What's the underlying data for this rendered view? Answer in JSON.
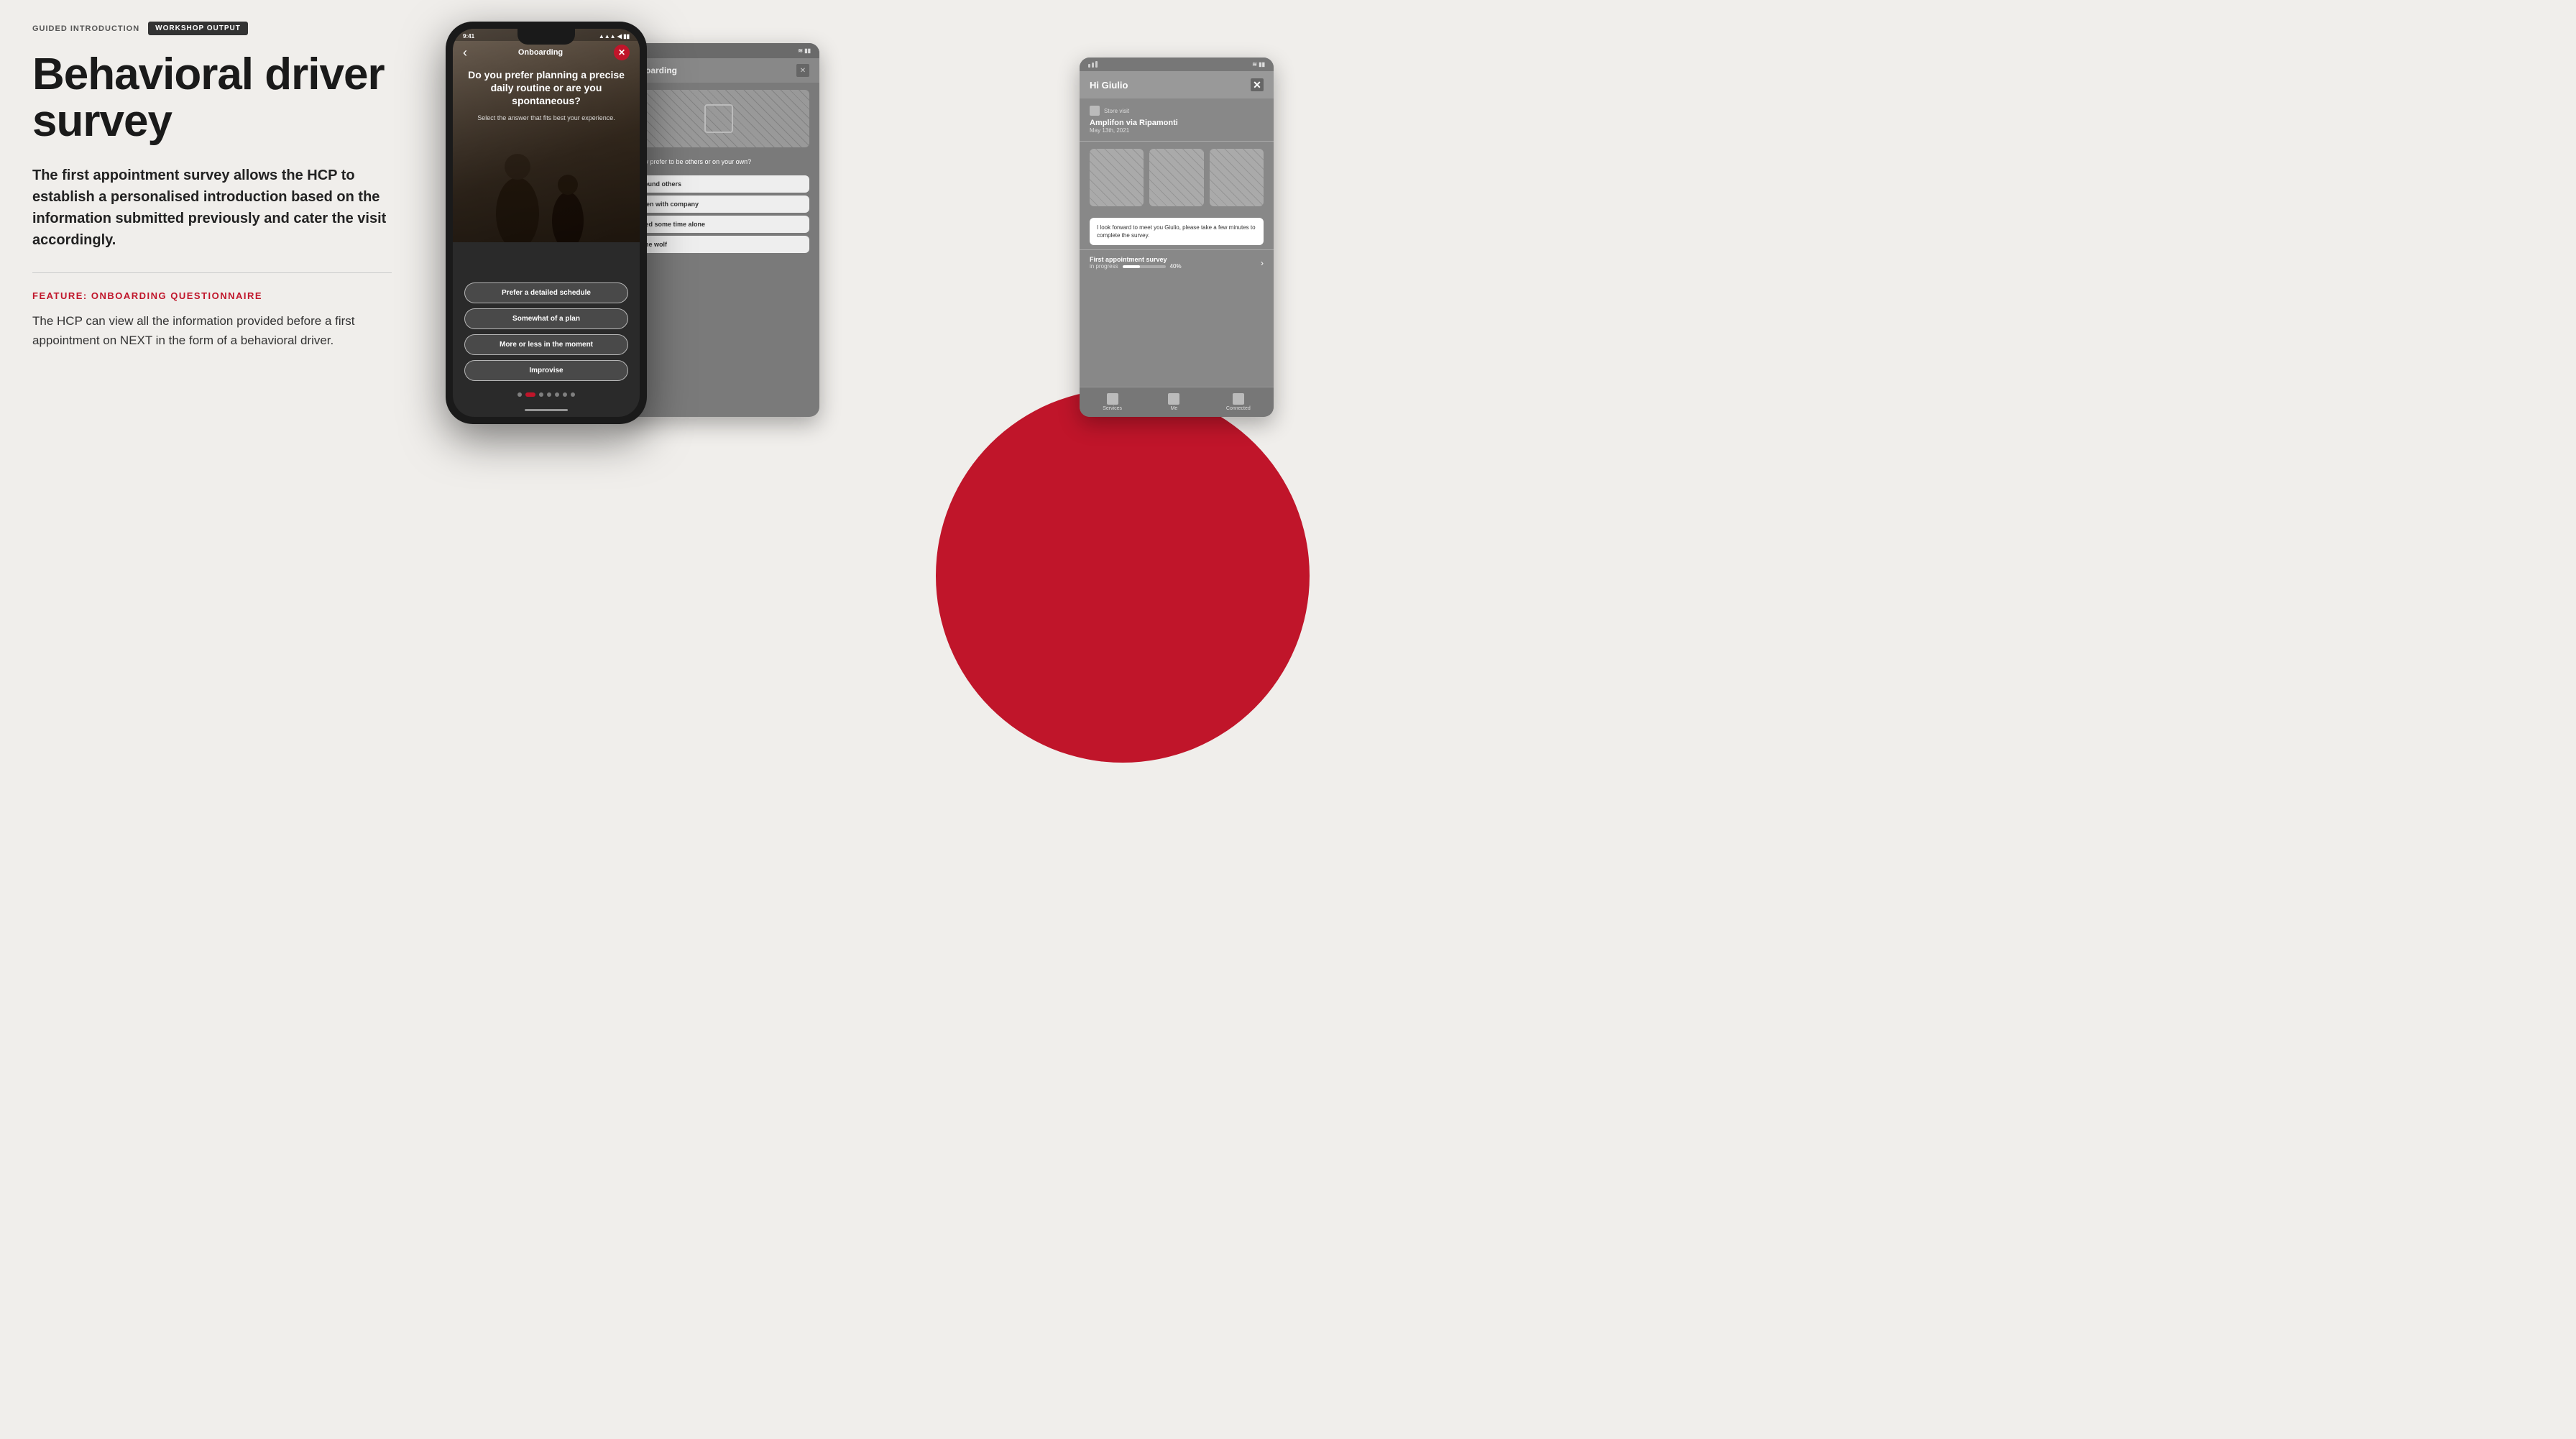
{
  "breadcrumb": {
    "text": "GUIDED INTRODUCTION",
    "badge": "WORKSHOP OUTPUT"
  },
  "title": "Behavioral driver survey",
  "description": "The first appointment survey allows the HCP to establish a personalised introduction based on the information submitted previously and cater the visit accordingly.",
  "feature": {
    "label": "FEATURE: ONBOARDING QUESTIONNAIRE",
    "description": "The HCP can view all the information provided before a first appointment on NEXT in the form of a behavioral driver."
  },
  "phone": {
    "status_time": "9:41",
    "nav_title": "Onboarding",
    "question": "Do you prefer planning a precise daily routine or are you spontaneous?",
    "sub_question": "Select the answer that fits best your experience.",
    "answers": [
      "Prefer a detailed schedule",
      "Somewhat of a plan",
      "More or less in the moment",
      "Improvise"
    ]
  },
  "middle_panel": {
    "header_title": "Onboarding",
    "question_text": "usually prefer to be others or on your own?",
    "options": [
      "Around others",
      "Often with company",
      "Need some time alone",
      "Lone wolf"
    ]
  },
  "right_panel": {
    "header_title": "Hi Giulio",
    "store_label": "Store visit",
    "store_name": "Amplifon via Ripamonti",
    "store_date": "May 13th, 2021",
    "message": "I look forward to meet you Giulio, please take a few minutes to complete the survey.",
    "survey_label": "First appointment survey",
    "progress_label": "in progress",
    "progress_value": "40%",
    "nav_items": [
      "Services",
      "Me",
      "Connected"
    ]
  }
}
